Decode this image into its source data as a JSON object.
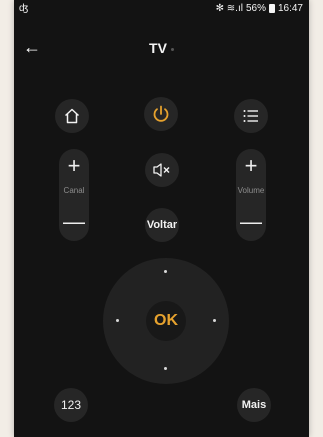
{
  "status_bar": {
    "app_icon": "app-notification-icon",
    "app_icon_glyph": "ʤ",
    "indicators": "✻ ≋.ıl",
    "battery_text": "56%",
    "time": "16:47"
  },
  "header": {
    "back_glyph": "←",
    "title": "TV"
  },
  "buttons": {
    "home": "home-icon",
    "power": "power-icon",
    "menu": "menu-icon",
    "mute": "mute-icon",
    "voltar": "Voltar",
    "ok": "OK",
    "numbers": "123",
    "mais": "Mais"
  },
  "channel": {
    "label": "Canal",
    "plus": "+",
    "minus": "—"
  },
  "volume": {
    "label": "Volume",
    "plus": "+",
    "minus": "—"
  },
  "colors": {
    "accent": "#e6a22e",
    "background": "#131313",
    "button": "#262626"
  }
}
